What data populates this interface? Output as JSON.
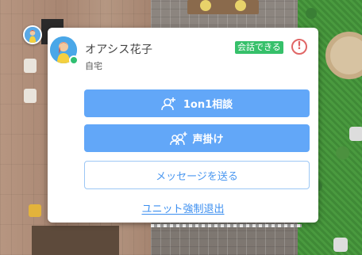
{
  "user": {
    "name": "オアシス花子",
    "location": "自宅",
    "status_badge": "会話できる"
  },
  "actions": {
    "one_on_one": "1on1相談",
    "call": "声掛け",
    "message": "メッセージを送る",
    "force_leave": "ユニット強制退出"
  },
  "icons": {
    "alert": "!"
  },
  "colors": {
    "primary_button": "#62a7f8",
    "outline_text": "#4a97f0",
    "status_green": "#36c06a",
    "presence_online": "#2fbf71",
    "alert_red": "#e06666"
  }
}
